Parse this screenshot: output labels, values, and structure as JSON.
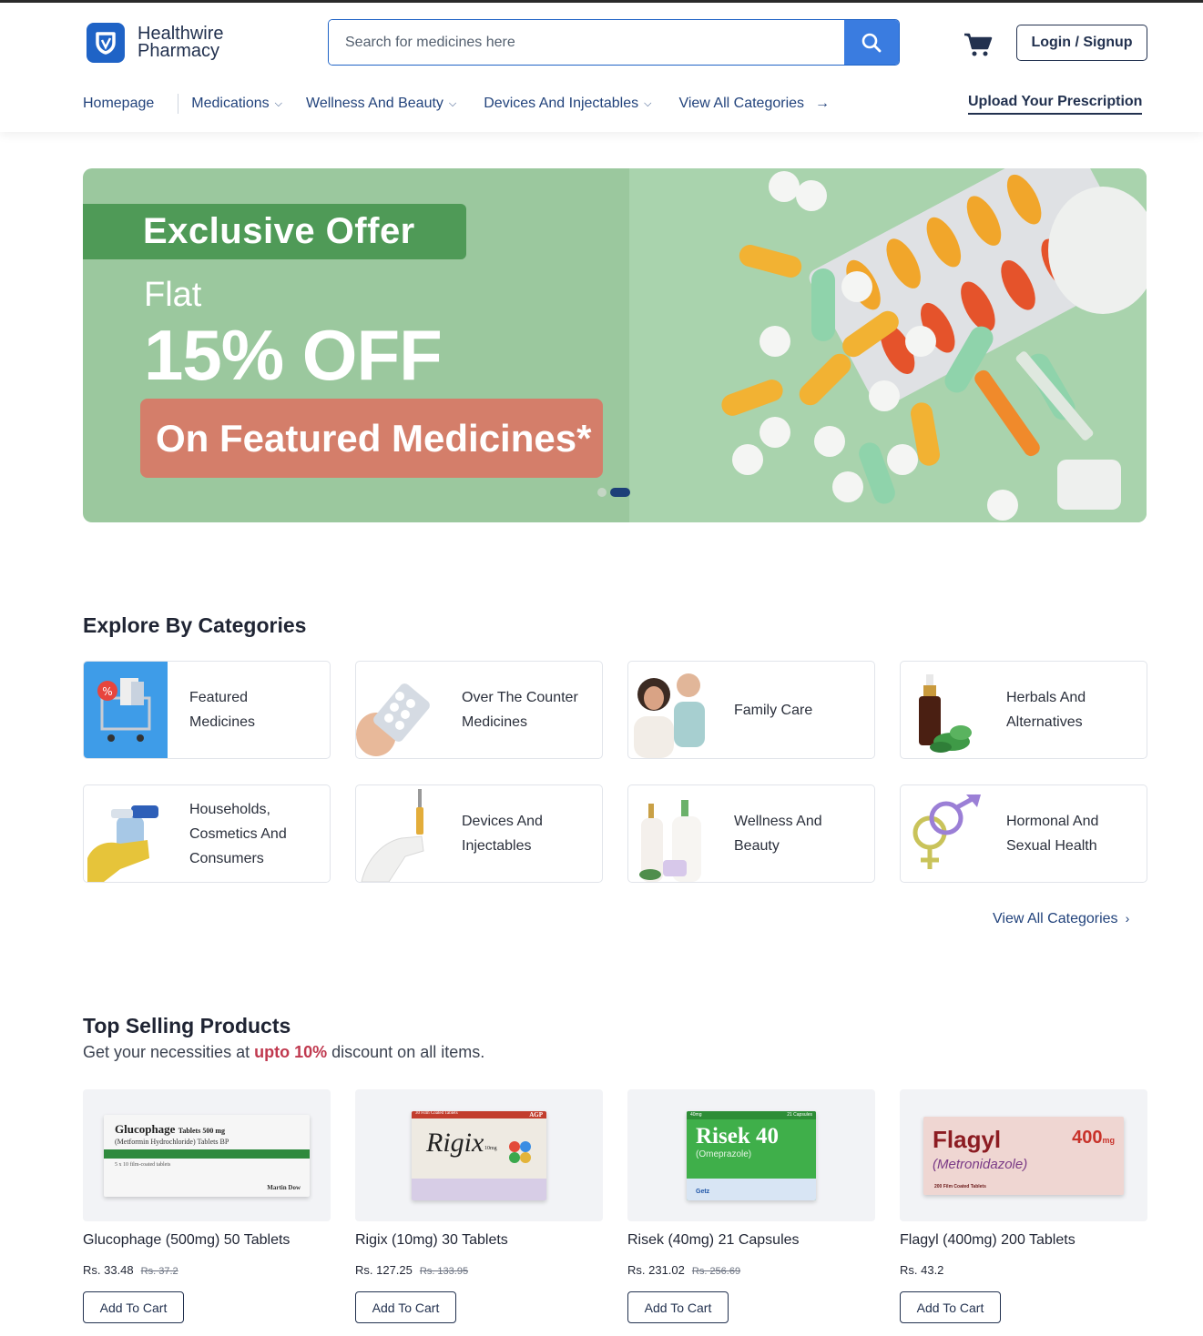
{
  "brand": {
    "line1": "Healthwire",
    "line2": "Pharmacy"
  },
  "search": {
    "placeholder": "Search for medicines here"
  },
  "header": {
    "login_label": "Login / Signup",
    "upload_label": "Upload Your Prescription"
  },
  "nav": {
    "items": [
      {
        "label": "Homepage"
      },
      {
        "label": "Medications"
      },
      {
        "label": "Wellness And Beauty"
      },
      {
        "label": "Devices And Injectables"
      },
      {
        "label": "View All Categories"
      }
    ]
  },
  "banner": {
    "tag": "Exclusive Offer",
    "flat": "Flat",
    "discount": "15% OFF",
    "featured": "On Featured Medicines*",
    "slides": 2,
    "active_slide": 2
  },
  "categories": {
    "title": "Explore By Categories",
    "view_all": "View All Categories",
    "items": [
      {
        "line1": "Featured",
        "line2": "Medicines",
        "line3": ""
      },
      {
        "line1": "Over The Counter",
        "line2": "Medicines",
        "line3": ""
      },
      {
        "line1": "Family Care",
        "line2": "",
        "line3": ""
      },
      {
        "line1": "Herbals And",
        "line2": "Alternatives",
        "line3": ""
      },
      {
        "line1": "Households,",
        "line2": "Cosmetics And",
        "line3": "Consumers"
      },
      {
        "line1": "Devices And",
        "line2": "Injectables",
        "line3": ""
      },
      {
        "line1": "Wellness And",
        "line2": "Beauty",
        "line3": ""
      },
      {
        "line1": "Hormonal And",
        "line2": "Sexual Health",
        "line3": ""
      }
    ]
  },
  "products": {
    "title": "Top Selling Products",
    "subtitle_pre": "Get your necessities at",
    "subtitle_hl": "upto 10%",
    "subtitle_post": "discount on all items.",
    "add_label": "Add To Cart",
    "items": [
      {
        "name": "Glucophage (500mg) 50 Tablets",
        "price": "Rs. 33.48",
        "old": "Rs. 37.2",
        "pack": {
          "brand": "Glucophage",
          "strength": "Tablets 500 mg",
          "generic": "(Metformin Hydrochloride) Tablets BP",
          "count": "5 x 10 film-coated tablets",
          "maker": "Martin Dow"
        }
      },
      {
        "name": "Rigix (10mg) 30 Tablets",
        "price": "Rs. 127.25",
        "old": "Rs. 133.95",
        "pack": {
          "brand": "Rigix",
          "strength": "10mg",
          "maker": "AGP",
          "top": "30 Film Coated Tablets"
        }
      },
      {
        "name": "Risek (40mg) 21 Capsules",
        "price": "Rs. 231.02",
        "old": "Rs. 256.69",
        "pack": {
          "brand": "Risek 40",
          "generic": "(Omeprazole)",
          "maker": "Getz",
          "strength": "40mg",
          "count": "21 Capsules"
        }
      },
      {
        "name": "Flagyl (400mg) 200 Tablets",
        "price": "Rs. 43.2",
        "old": "",
        "pack": {
          "brand": "Flagyl",
          "generic": "(Metronidazole)",
          "strength": "400",
          "unit": "mg",
          "count": "200 Film Coated Tablets"
        }
      }
    ]
  },
  "colors": {
    "primary": "#1f63c6",
    "navy": "#22314f",
    "banner_green": "#9bc89e",
    "tag_green": "#4f9a57",
    "pill_coral": "#d47e6a",
    "highlight": "#c0394f"
  }
}
